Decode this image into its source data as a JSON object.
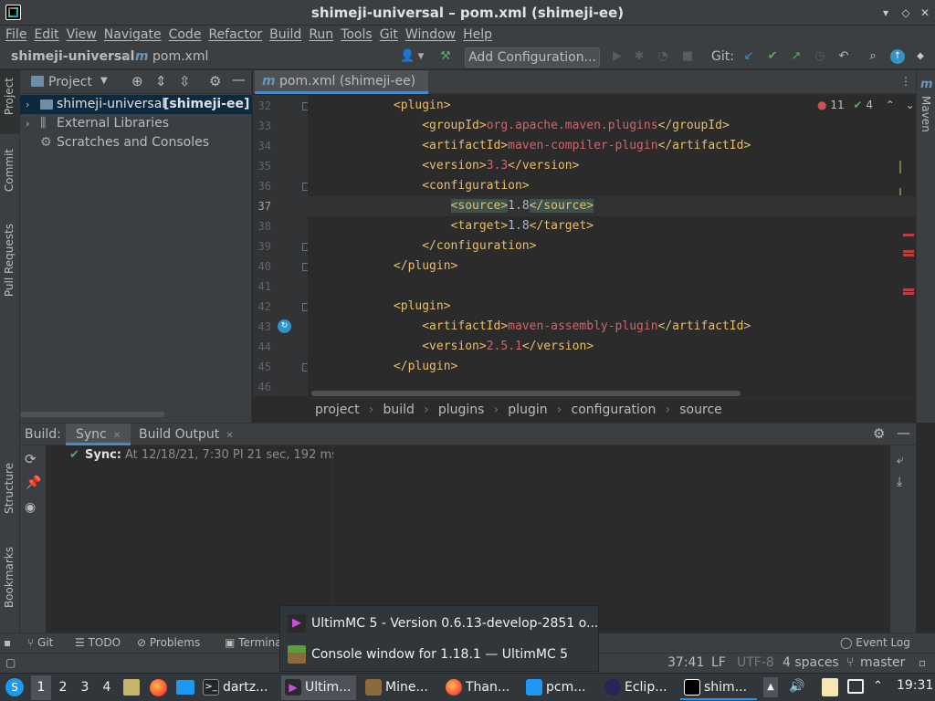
{
  "window": {
    "title": "shimeji-universal – pom.xml (shimeji-ee)"
  },
  "menu": [
    "File",
    "Edit",
    "View",
    "Navigate",
    "Code",
    "Refactor",
    "Build",
    "Run",
    "Tools",
    "Git",
    "Window",
    "Help"
  ],
  "nav": {
    "project": "shimeji-universal",
    "file": "pom.xml",
    "add_config": "Add Configuration...",
    "git_label": "Git:"
  },
  "left_strip": [
    "Project",
    "Commit",
    "Pull Requests",
    "Structure",
    "Bookmarks"
  ],
  "right_strip": [
    "Maven"
  ],
  "project_panel": {
    "header": "Project",
    "items": [
      {
        "name": "shimeji-universal",
        "suffix": "[shimeji-ee]"
      },
      {
        "name": "External Libraries"
      },
      {
        "name": "Scratches and Consoles"
      }
    ]
  },
  "editor": {
    "tab": "pom.xml (shimeji-ee)",
    "errors": "11",
    "warnings": "4",
    "lines": [
      {
        "n": "32",
        "indent": "            ",
        "pre": "<plugin>",
        "val": "",
        "post": ""
      },
      {
        "n": "33",
        "indent": "                ",
        "pre": "<groupId>",
        "val": "org.apache.maven.plugins",
        "post": "</groupId>"
      },
      {
        "n": "34",
        "indent": "                ",
        "pre": "<artifactId>",
        "val": "maven-compiler-plugin",
        "post": "</artifactId>"
      },
      {
        "n": "35",
        "indent": "                ",
        "pre": "<version>",
        "val": "3.3",
        "post": "</version>"
      },
      {
        "n": "36",
        "indent": "                ",
        "pre": "<configuration>",
        "val": "",
        "post": ""
      },
      {
        "n": "37",
        "indent": "                    ",
        "pre": "<source>",
        "val": "1.8",
        "post": "</source>"
      },
      {
        "n": "38",
        "indent": "                    ",
        "pre": "<target>",
        "val": "1.8",
        "post": "</target>"
      },
      {
        "n": "39",
        "indent": "                ",
        "pre": "</configuration>",
        "val": "",
        "post": ""
      },
      {
        "n": "40",
        "indent": "            ",
        "pre": "</plugin>",
        "val": "",
        "post": ""
      },
      {
        "n": "41",
        "indent": "",
        "pre": "",
        "val": "",
        "post": ""
      },
      {
        "n": "42",
        "indent": "            ",
        "pre": "<plugin>",
        "val": "",
        "post": ""
      },
      {
        "n": "43",
        "indent": "                ",
        "pre": "<artifactId>",
        "val": "maven-assembly-plugin",
        "post": "</artifactId>"
      },
      {
        "n": "44",
        "indent": "                ",
        "pre": "<version>",
        "val": "2.5.1",
        "post": "</version>"
      },
      {
        "n": "45",
        "indent": "            ",
        "pre": "</plugin>",
        "val": "",
        "post": ""
      },
      {
        "n": "46",
        "indent": "",
        "pre": "",
        "val": "",
        "post": ""
      }
    ],
    "breadcrumb": [
      "project",
      "build",
      "plugins",
      "plugin",
      "configuration",
      "source"
    ]
  },
  "build": {
    "label": "Build:",
    "tabs": [
      "Sync",
      "Build Output"
    ],
    "sync_label": "Sync:",
    "sync_text": "At 12/18/21, 7:30 PI 21 sec, 192 ms"
  },
  "bottom_tools": [
    "Git",
    "TODO",
    "Problems",
    "Termina",
    "Event Log"
  ],
  "status": {
    "pos": "37:41",
    "le": "LF",
    "enc": "UTF-8",
    "indent": "4 spaces",
    "branch": "master"
  },
  "popup": [
    "UltimMC 5 - Version 0.6.13-develop-2851 o...",
    "Console window for 1.18.1 — UltimMC 5"
  ],
  "taskbar": {
    "desktops": [
      "1",
      "2",
      "3",
      "4"
    ],
    "tasks": [
      "dartz...",
      "Ultim...",
      "Mine...",
      "Than...",
      "pcm...",
      "Eclip...",
      "shim..."
    ],
    "clock": "19:31"
  },
  "colors": {
    "accent": "#4a88c7",
    "tag": "#e8bf6a",
    "value": "#6a8759",
    "string": "#cc666e"
  }
}
